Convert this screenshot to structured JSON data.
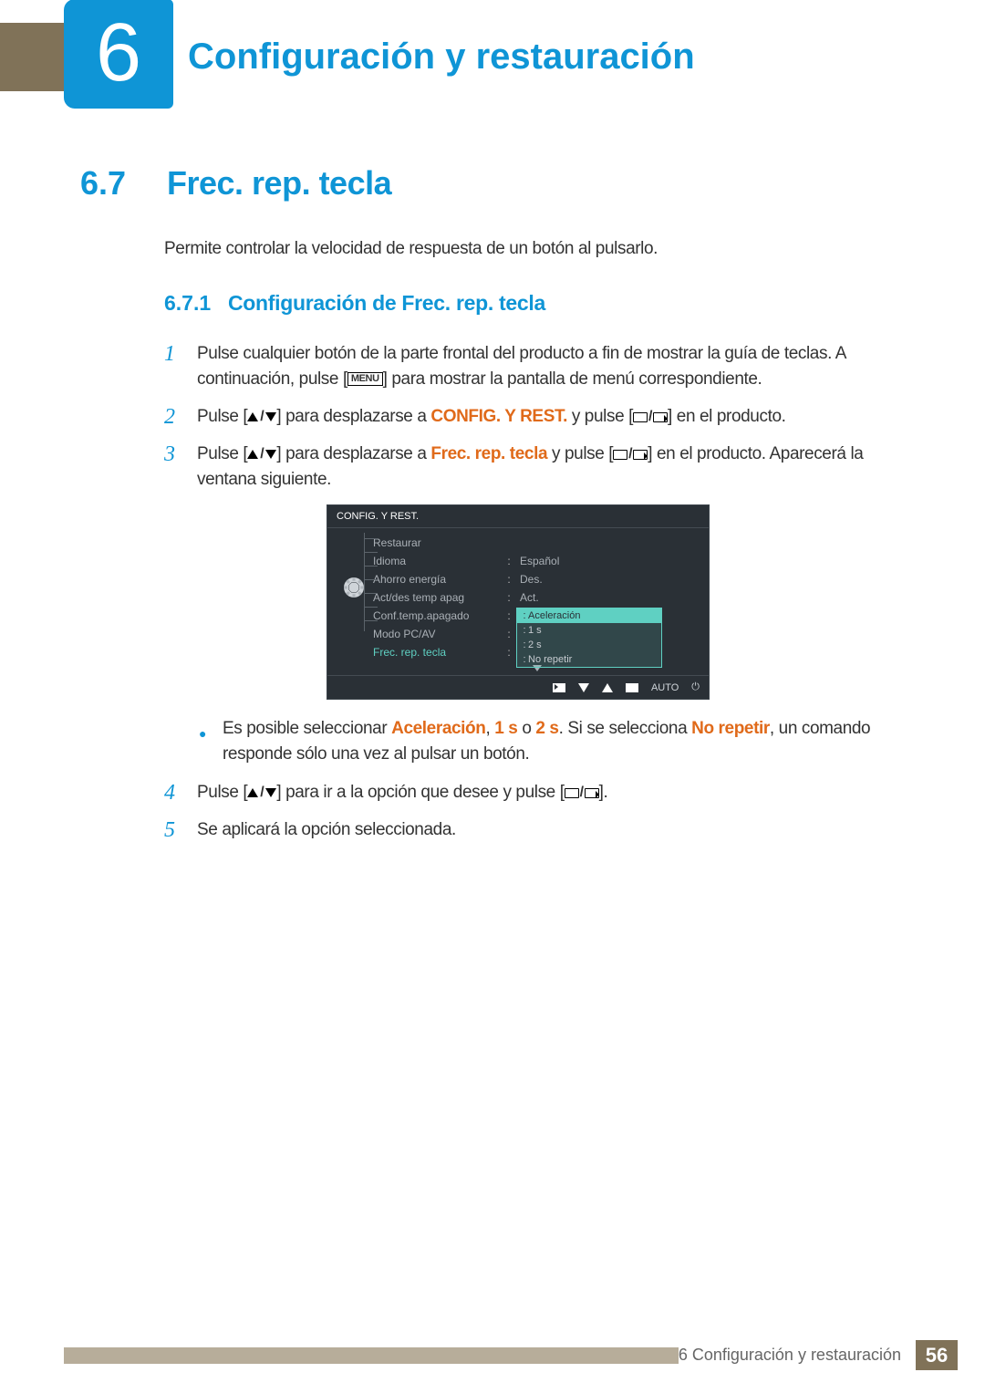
{
  "chapter": {
    "number": "6",
    "title": "Configuración y restauración"
  },
  "section": {
    "number": "6.7",
    "title": "Frec. rep. tecla"
  },
  "intro": "Permite controlar la velocidad de respuesta de un botón al pulsarlo.",
  "subsection": {
    "number": "6.7.1",
    "title": "Configuración de Frec. rep. tecla"
  },
  "steps": {
    "s1a": "Pulse cualquier botón de la parte frontal del producto a fin de mostrar la guía de teclas. A continuación, pulse [",
    "s1b": "] para mostrar la pantalla de menú correspondiente.",
    "s2a": "Pulse [",
    "s2b": "] para desplazarse a ",
    "s2c": "CONFIG. Y REST.",
    "s2d": " y pulse [",
    "s2e": "] en el producto.",
    "s3a": "Pulse [",
    "s3b": "] para desplazarse a ",
    "s3c": "Frec. rep. tecla",
    "s3d": " y pulse [",
    "s3e": "] en el producto. Aparecerá la ventana siguiente.",
    "s4a": "Pulse [",
    "s4b": "] para ir a la opción que desee y pulse [",
    "s4c": "].",
    "s5": "Se aplicará la opción seleccionada.",
    "n1": "1",
    "n2": "2",
    "n3": "3",
    "n4": "4",
    "n5": "5"
  },
  "menu_key": "MENU",
  "bullet": {
    "a": "Es posible seleccionar ",
    "acc": "Aceleración",
    "b": ", ",
    "one": "1 s",
    "c": " o ",
    "two": "2 s",
    "d": ". Si se selecciona ",
    "nr": "No repetir",
    "e": ", un comando responde sólo una vez al pulsar un botón."
  },
  "osd": {
    "title": "CONFIG. Y REST.",
    "rows": [
      {
        "label": "Restaurar",
        "value": ""
      },
      {
        "label": "Idioma",
        "value": "Español"
      },
      {
        "label": "Ahorro energía",
        "value": "Des."
      },
      {
        "label": "Act/des temp apag",
        "value": "Act."
      },
      {
        "label": "Conf.temp.apagado",
        "value": ""
      },
      {
        "label": "Modo PC/AV",
        "value": ""
      },
      {
        "label": "Frec. rep. tecla",
        "value": ""
      }
    ],
    "dropdown": [
      "Aceleración",
      "1 s",
      "2 s",
      "No repetir"
    ],
    "auto": "AUTO"
  },
  "footer": {
    "text": "6 Configuración y restauración",
    "page": "56"
  }
}
